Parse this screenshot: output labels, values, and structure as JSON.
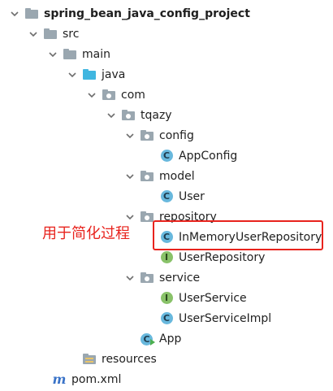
{
  "project_tree": {
    "root": {
      "label": "spring_bean_java_config_project",
      "icon": "folder-icon"
    },
    "src": {
      "label": "src",
      "icon": "folder-icon"
    },
    "main": {
      "label": "main",
      "icon": "folder-icon"
    },
    "java": {
      "label": "java",
      "icon": "source-root-folder-icon"
    },
    "com": {
      "label": "com",
      "icon": "package-icon"
    },
    "tqazy": {
      "label": "tqazy",
      "icon": "package-icon"
    },
    "config": {
      "label": "config",
      "icon": "package-icon"
    },
    "appconfig": {
      "label": "AppConfig",
      "icon": "class-icon"
    },
    "model": {
      "label": "model",
      "icon": "package-icon"
    },
    "user": {
      "label": "User",
      "icon": "class-icon"
    },
    "repository": {
      "label": "repository",
      "icon": "package-icon"
    },
    "inmemory": {
      "label": "InMemoryUserRepository",
      "icon": "class-icon"
    },
    "userrepository": {
      "label": "UserRepository",
      "icon": "interface-icon"
    },
    "service": {
      "label": "service",
      "icon": "package-icon"
    },
    "userservice": {
      "label": "UserService",
      "icon": "interface-icon"
    },
    "userserviceimpl": {
      "label": "UserServiceImpl",
      "icon": "class-icon"
    },
    "app": {
      "label": "App",
      "icon": "runnable-class-icon"
    },
    "resources": {
      "label": "resources",
      "icon": "resources-folder-icon"
    },
    "pom": {
      "label": "pom.xml",
      "icon": "maven-icon"
    }
  },
  "glyphs": {
    "class": "C",
    "interface": "I",
    "maven": "m"
  },
  "annotation": {
    "text": "用于简化过程",
    "color": "#e8231d"
  },
  "colors": {
    "folder": "#9aa7b0",
    "source_root": "#40b6e0",
    "class_icon": "#68b8dd",
    "interface_icon": "#89c269",
    "maven": "#3a73c8",
    "highlight": "#e8231d"
  }
}
